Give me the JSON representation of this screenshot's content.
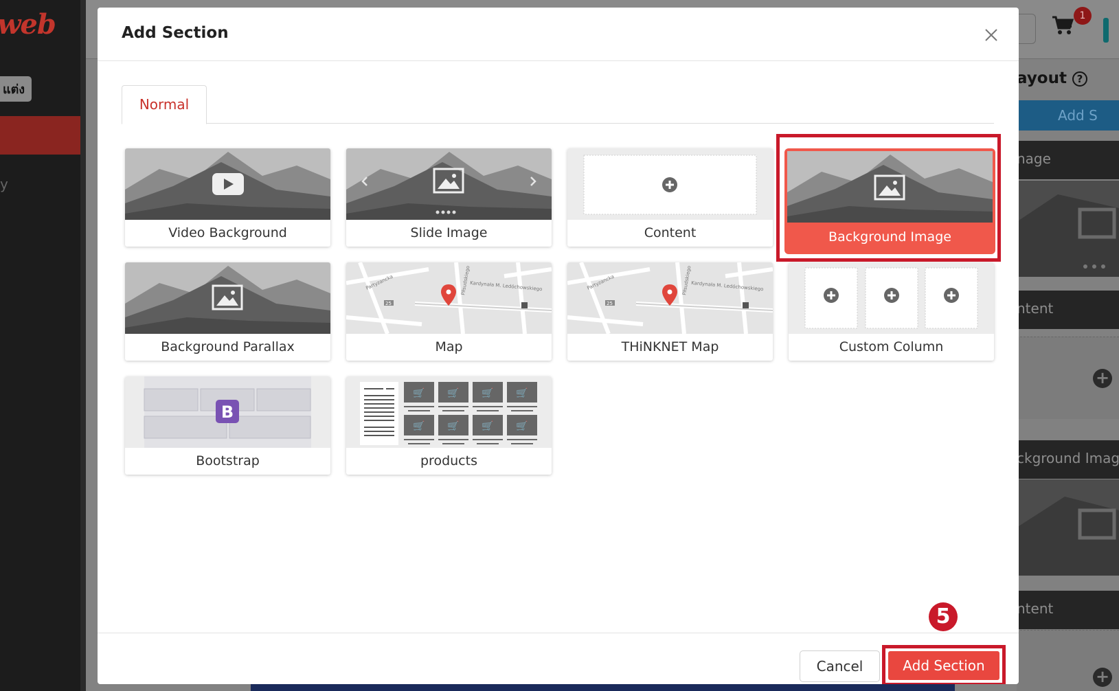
{
  "background": {
    "logo_text": "web",
    "sidebar_pill": "แต่ง",
    "sidebar_fragment": "y",
    "cart_badge": "1",
    "layout_title": "ayout",
    "add_section_fragment": "Add S",
    "rows": [
      "nage",
      "ntent",
      "ckground Image",
      "ntent"
    ]
  },
  "modal": {
    "title": "Add Section",
    "tabs": [
      {
        "label": "Normal",
        "active": true
      }
    ],
    "cards": [
      {
        "label": "Video Background",
        "icon": "video-play-icon"
      },
      {
        "label": "Slide Image",
        "icon": "image-icon"
      },
      {
        "label": "Content",
        "icon": "add-icon"
      },
      {
        "label": "Background Image",
        "icon": "image-icon",
        "selected": true
      },
      {
        "label": "Background Parallax",
        "icon": "image-icon"
      },
      {
        "label": "Map",
        "icon": "map-pin-icon"
      },
      {
        "label": "THiNKNET Map",
        "icon": "map-pin-icon"
      },
      {
        "label": "Custom Column",
        "icon": "add-icon"
      },
      {
        "label": "Bootstrap",
        "icon": "bootstrap-icon",
        "icon_letter": "B"
      },
      {
        "label": "products",
        "icon": "cart-icon"
      }
    ],
    "map_street_labels": [
      "Partyzancka",
      "Kardynała M. Ledóchowskiego",
      "Piłsudskiego",
      "25"
    ],
    "footer": {
      "cancel_label": "Cancel",
      "add_label": "Add Section"
    },
    "step_marker": "5"
  },
  "colors": {
    "accent": "#e9473f",
    "selected_card": "#f0584b",
    "highlight_frame": "#c9192a",
    "tab_active_text": "#c8312a"
  }
}
